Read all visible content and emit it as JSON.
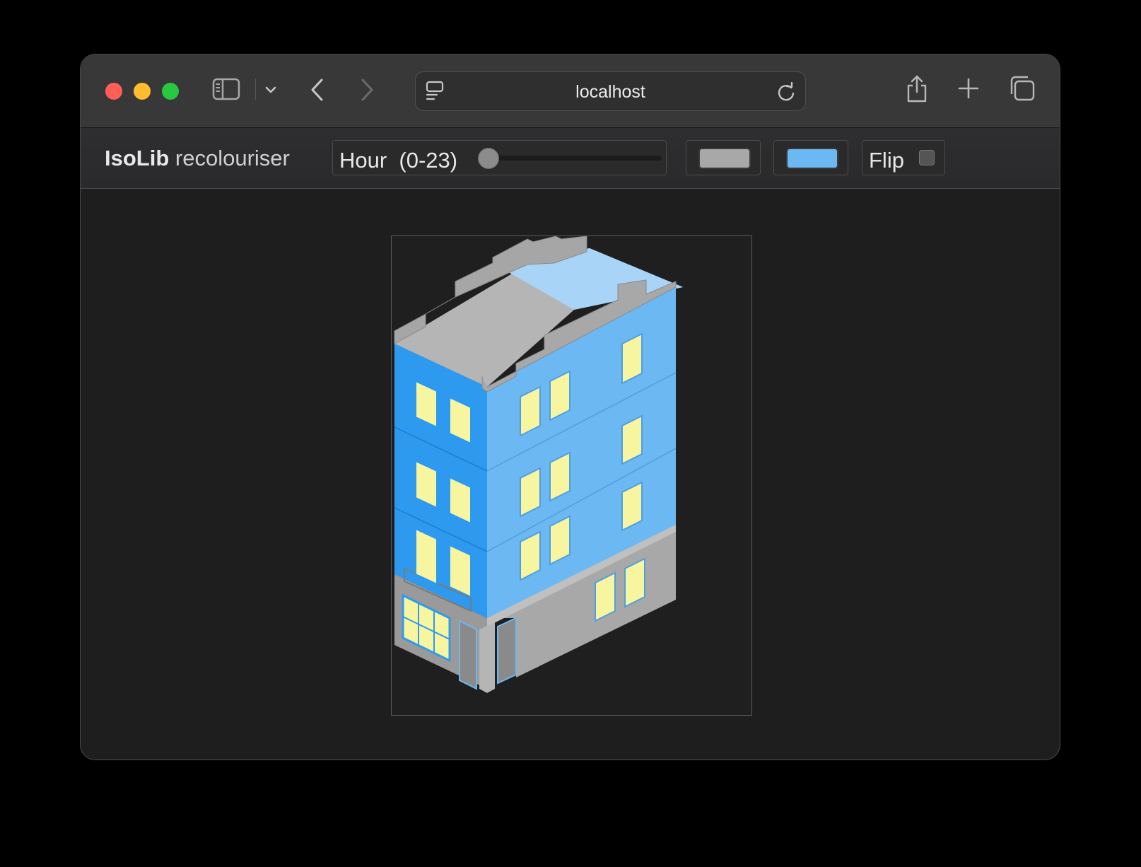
{
  "browser": {
    "url": "localhost",
    "traffic_colors": {
      "close": "#ff5f57",
      "minimize": "#febc2e",
      "zoom": "#28c840"
    }
  },
  "app": {
    "brand_bold": "IsoLib",
    "brand_light": "recolouriser",
    "hour": {
      "label": "Hour  (0-23)",
      "value": 0,
      "min": 0,
      "max": 23
    },
    "color_primary": "#a8a8a8",
    "color_secondary": "#6cb8f2",
    "flip": {
      "label": "Flip",
      "checked": false
    }
  },
  "building": {
    "wall_left": "#2d9af0",
    "wall_right": "#6cb8f2",
    "roof": "#b5b5b5",
    "roof_light": "#a8d4f8",
    "stone": "#a8a8a8",
    "window_glass": "#f8f5a0"
  }
}
